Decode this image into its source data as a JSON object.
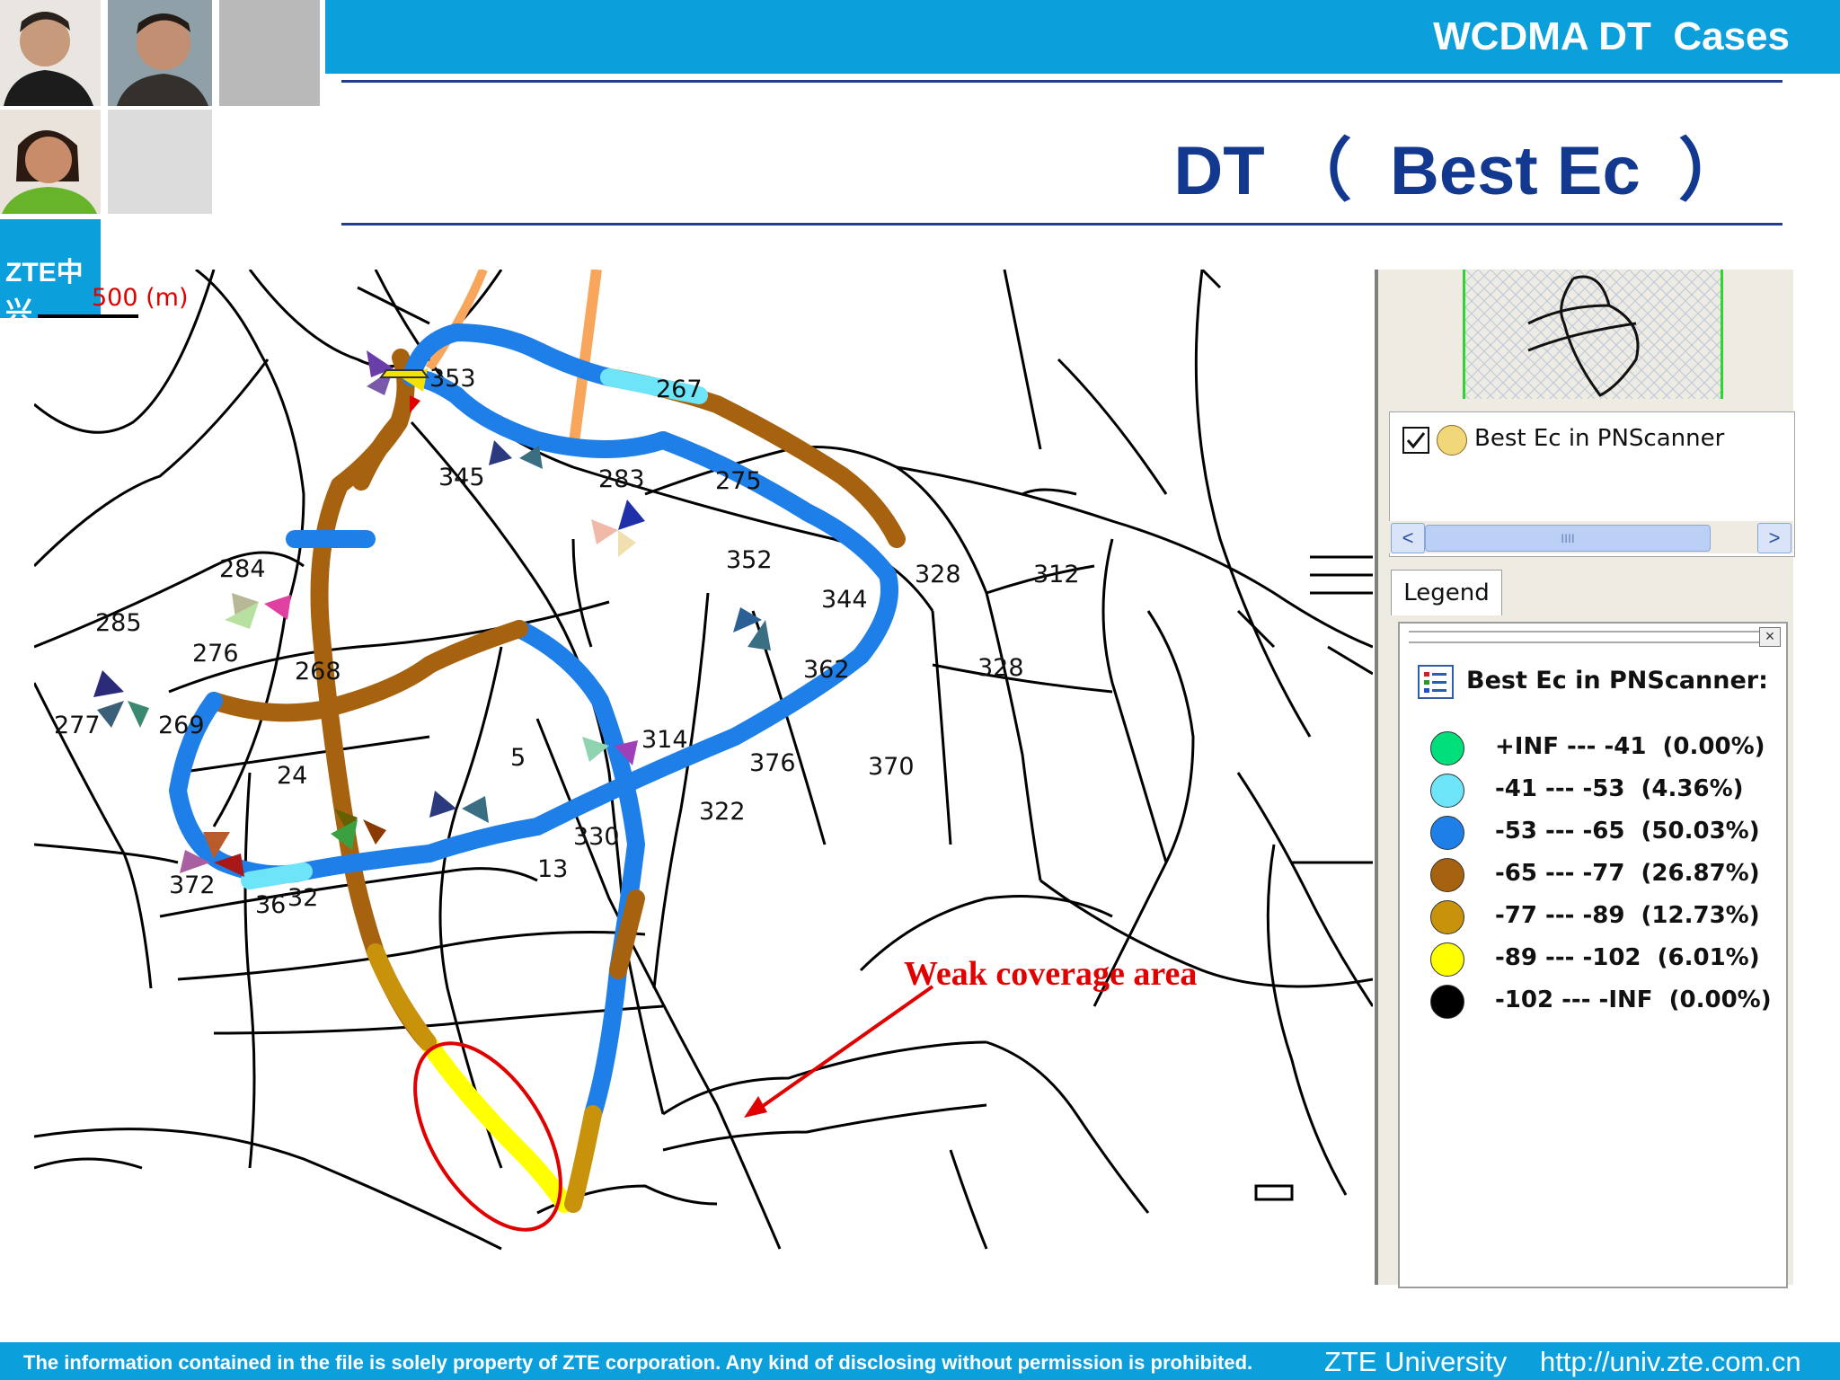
{
  "header": {
    "title": "WCDMA DT  Cases"
  },
  "page": {
    "title": "DT （  Best Ec  ）"
  },
  "logo": {
    "text": "ZTE中兴"
  },
  "map": {
    "scale_label": "500 (m)",
    "annotation": "Weak coverage area",
    "site_labels": [
      "353",
      "267",
      "345",
      "283",
      "275",
      "352",
      "344",
      "328",
      "312",
      "328",
      "284",
      "285",
      "276",
      "268",
      "277",
      "269",
      "362",
      "5",
      "314",
      "376",
      "370",
      "24",
      "322",
      "330",
      "13",
      "372",
      "36",
      "32"
    ]
  },
  "panel": {
    "layer_name": "Best Ec in PNScanner",
    "scroll_thumb": "IIII",
    "tab_label": "Legend",
    "legend_title": "Best Ec in PNScanner:",
    "legend_close": "×",
    "scroll_left": "<",
    "scroll_right": ">",
    "legend": [
      {
        "range": "+INF --- -41",
        "pct": "(0.00%)",
        "color": "#00e07a"
      },
      {
        "range": "-41 --- -53",
        "pct": "(4.36%)",
        "color": "#6de4f7"
      },
      {
        "range": "-53 --- -65",
        "pct": "(50.03%)",
        "color": "#1e7fe8"
      },
      {
        "range": "-65 --- -77",
        "pct": "(26.87%)",
        "color": "#a6620f"
      },
      {
        "range": "-77 --- -89",
        "pct": "(12.73%)",
        "color": "#c9920b"
      },
      {
        "range": "-89 --- -102",
        "pct": "(6.01%)",
        "color": "#ffff00"
      },
      {
        "range": "-102 --- -INF",
        "pct": "(0.00%)",
        "color": "#000000"
      }
    ]
  },
  "footer": {
    "note": "The information contained in the file is solely property of ZTE corporation. Any kind of disclosing without permission is prohibited.",
    "university": "ZTE University",
    "url": "http://univ.zte.com.cn"
  }
}
